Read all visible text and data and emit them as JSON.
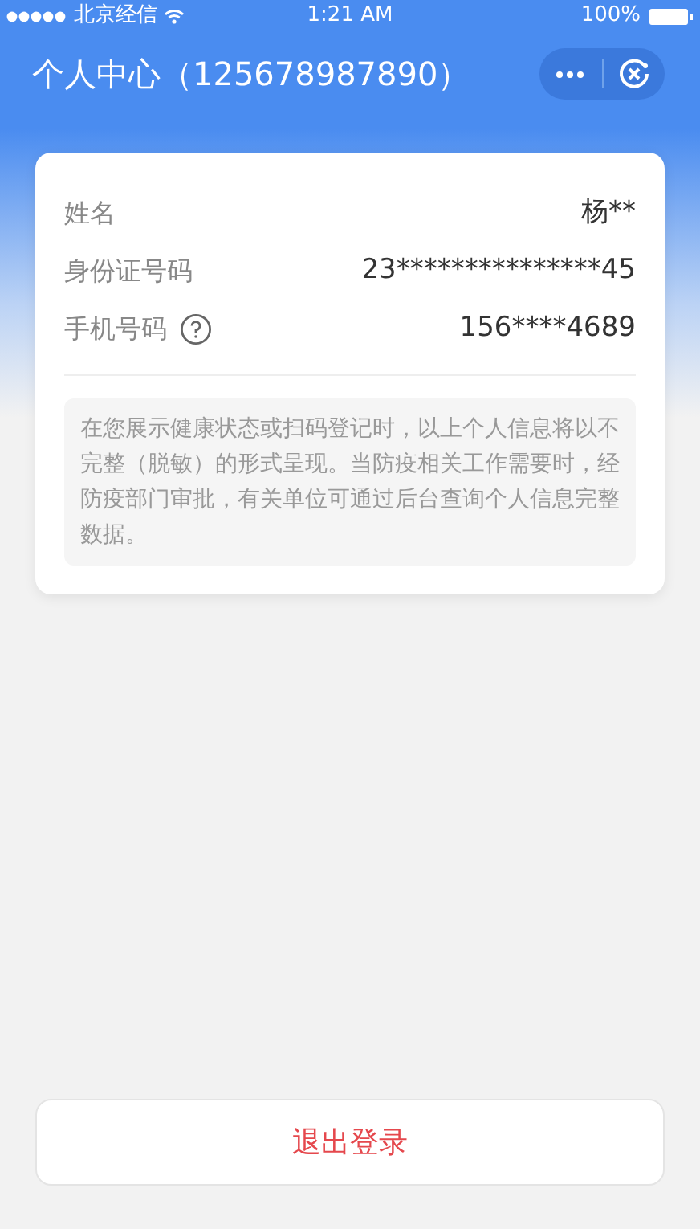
{
  "status_bar": {
    "carrier": "北京经信",
    "time": "1:21 AM",
    "battery": "100%"
  },
  "nav": {
    "title": "个人中心（125678987890）"
  },
  "profile": {
    "rows": [
      {
        "kind": "plain",
        "label": "姓名",
        "value": "杨**"
      },
      {
        "kind": "plain",
        "label": "身份证号码",
        "value": "23***************45"
      },
      {
        "kind": "help",
        "label": "手机号码",
        "value": "156****4689"
      }
    ],
    "notice": "在您展示健康状态或扫码登记时，以上个人信息将以不完整（脱敏）的形式呈现。当防疫相关工作需要时，经防疫部门审批，有关单位可通过后台查询个人信息完整数据。"
  },
  "logout_button": "退出登录"
}
